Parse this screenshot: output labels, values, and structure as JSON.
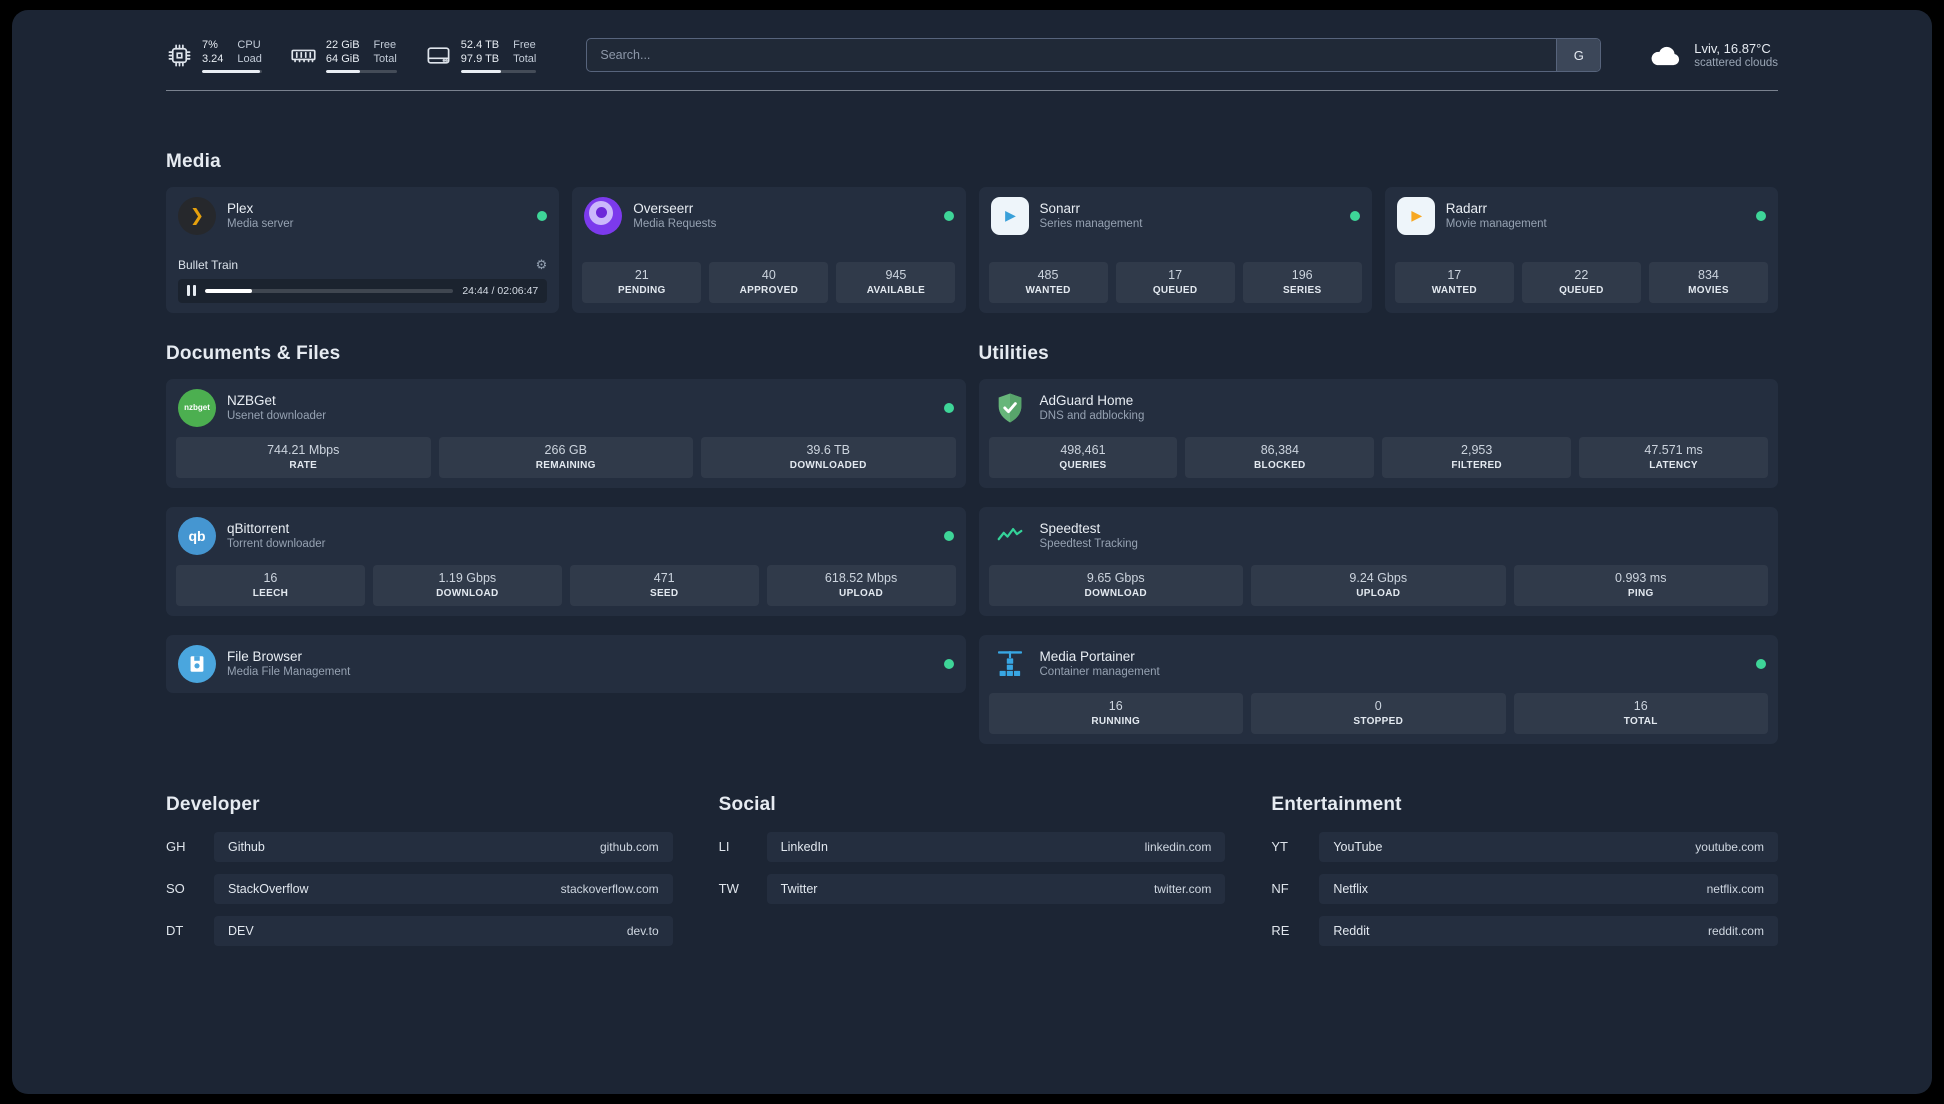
{
  "topbar": {
    "resources": [
      {
        "name": "cpu",
        "v1": "7%",
        "v2": "3.24",
        "l1": "CPU",
        "l2": "Load",
        "pct": 96
      },
      {
        "name": "memory",
        "v1": "22 GiB",
        "v2": "64 GiB",
        "l1": "Free",
        "l2": "Total",
        "pct": 48
      },
      {
        "name": "disk",
        "v1": "52.4 TB",
        "v2": "97.9 TB",
        "l1": "Free",
        "l2": "Total",
        "pct": 53
      }
    ],
    "search": {
      "placeholder": "Search...",
      "button_label": "G"
    },
    "weather": {
      "location": "Lviv, 16.87°C",
      "condition": "scattered clouds"
    }
  },
  "sections": {
    "media": "Media",
    "documents": "Documents & Files",
    "utilities": "Utilities",
    "developer": "Developer",
    "social": "Social",
    "entertainment": "Entertainment"
  },
  "services": {
    "plex": {
      "name": "Plex",
      "subtitle": "Media server",
      "player_title": "Bullet Train",
      "player_time": "24:44 / 02:06:47",
      "player_pct": 19
    },
    "overseerr": {
      "name": "Overseerr",
      "subtitle": "Media Requests",
      "stats": [
        {
          "value": "21",
          "label": "PENDING"
        },
        {
          "value": "40",
          "label": "APPROVED"
        },
        {
          "value": "945",
          "label": "AVAILABLE"
        }
      ]
    },
    "sonarr": {
      "name": "Sonarr",
      "subtitle": "Series management",
      "stats": [
        {
          "value": "485",
          "label": "WANTED"
        },
        {
          "value": "17",
          "label": "QUEUED"
        },
        {
          "value": "196",
          "label": "SERIES"
        }
      ]
    },
    "radarr": {
      "name": "Radarr",
      "subtitle": "Movie management",
      "stats": [
        {
          "value": "17",
          "label": "WANTED"
        },
        {
          "value": "22",
          "label": "QUEUED"
        },
        {
          "value": "834",
          "label": "MOVIES"
        }
      ]
    },
    "nzbget": {
      "name": "NZBGet",
      "subtitle": "Usenet downloader",
      "icon_text": "nzbget",
      "stats": [
        {
          "value": "744.21 Mbps",
          "label": "RATE"
        },
        {
          "value": "266 GB",
          "label": "REMAINING"
        },
        {
          "value": "39.6 TB",
          "label": "DOWNLOADED"
        }
      ]
    },
    "qbittorrent": {
      "name": "qBittorrent",
      "subtitle": "Torrent downloader",
      "icon_text": "qb",
      "stats": [
        {
          "value": "16",
          "label": "LEECH"
        },
        {
          "value": "1.19 Gbps",
          "label": "DOWNLOAD"
        },
        {
          "value": "471",
          "label": "SEED"
        },
        {
          "value": "618.52 Mbps",
          "label": "UPLOAD"
        }
      ]
    },
    "filebrowser": {
      "name": "File Browser",
      "subtitle": "Media File Management"
    },
    "adguard": {
      "name": "AdGuard Home",
      "subtitle": "DNS and adblocking",
      "stats": [
        {
          "value": "498,461",
          "label": "QUERIES"
        },
        {
          "value": "86,384",
          "label": "BLOCKED"
        },
        {
          "value": "2,953",
          "label": "FILTERED"
        },
        {
          "value": "47.571 ms",
          "label": "LATENCY"
        }
      ]
    },
    "speedtest": {
      "name": "Speedtest",
      "subtitle": "Speedtest Tracking",
      "stats": [
        {
          "value": "9.65 Gbps",
          "label": "DOWNLOAD"
        },
        {
          "value": "9.24 Gbps",
          "label": "UPLOAD"
        },
        {
          "value": "0.993 ms",
          "label": "PING"
        }
      ]
    },
    "portainer": {
      "name": "Media Portainer",
      "subtitle": "Container management",
      "stats": [
        {
          "value": "16",
          "label": "RUNNING"
        },
        {
          "value": "0",
          "label": "STOPPED"
        },
        {
          "value": "16",
          "label": "TOTAL"
        }
      ]
    }
  },
  "bookmarks": {
    "developer": [
      {
        "abbr": "GH",
        "name": "Github",
        "url": "github.com"
      },
      {
        "abbr": "SO",
        "name": "StackOverflow",
        "url": "stackoverflow.com"
      },
      {
        "abbr": "DT",
        "name": "DEV",
        "url": "dev.to"
      }
    ],
    "social": [
      {
        "abbr": "LI",
        "name": "LinkedIn",
        "url": "linkedin.com"
      },
      {
        "abbr": "TW",
        "name": "Twitter",
        "url": "twitter.com"
      }
    ],
    "entertainment": [
      {
        "abbr": "YT",
        "name": "YouTube",
        "url": "youtube.com"
      },
      {
        "abbr": "NF",
        "name": "Netflix",
        "url": "netflix.com"
      },
      {
        "abbr": "RE",
        "name": "Reddit",
        "url": "reddit.com"
      }
    ]
  },
  "colors": {
    "panel_bg": "#1c2534",
    "card_bg": "#242e3f",
    "status_green": "#3ed598",
    "plex_orange": "#e5a00d",
    "sonarr_blue": "#39a0d9",
    "radarr_orange": "#f7a823",
    "overseerr_purple": "#7c3aed",
    "nzbget_green": "#4caf50",
    "qbittorrent_blue": "#4596d1",
    "filebrowser_blue": "#4aa6de",
    "adguard_green": "#67b67a",
    "speedtest_green": "#34d399",
    "portainer_blue": "#38a6e3"
  }
}
